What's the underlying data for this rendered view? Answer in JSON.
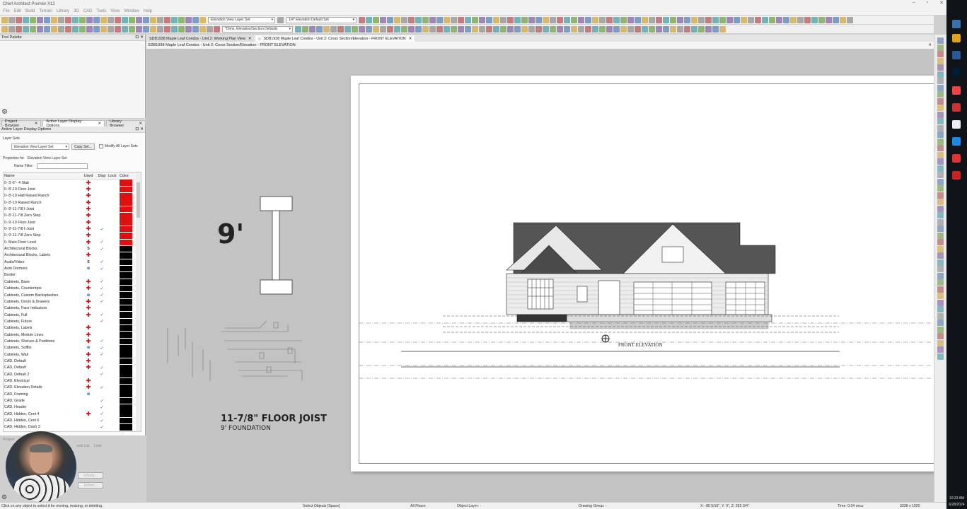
{
  "app": {
    "title": "Chief Architect Premier X12",
    "menus": [
      "File",
      "Edit",
      "Build",
      "Terrain",
      "Library",
      "3D",
      "CAD",
      "Tools",
      "View",
      "Window",
      "Help"
    ]
  },
  "toolbar": {
    "layer_set": "Elevation View Layer Set",
    "dims_default": "*Dims, Elevation/Section Defaults",
    "scale": "1/4\" Elevation Default Set"
  },
  "tool_palette": {
    "title": "Tool Palette"
  },
  "left_tabs": [
    {
      "label": "Project Browser"
    },
    {
      "label": "Active Layer Display Options"
    },
    {
      "label": "Library Browser"
    }
  ],
  "layer_panel": {
    "title": "Active Layer Display Options",
    "layer_sets_label": "Layer Sets",
    "layer_set_value": "Elevation View Layer Set",
    "copy_set": "Copy Set...",
    "modify_all": "Modify All Layer Sets",
    "properties_for": "Properties for",
    "properties_value": "Elevation View Layer Set",
    "name_filter": "Name Filter:",
    "columns": [
      "Name",
      "Used",
      "Disp",
      "Lock",
      "Color"
    ],
    "rows": [
      {
        "name": "0- 3'-6\"- 4 Slab",
        "used": "x",
        "disp": false,
        "color": "#e01010"
      },
      {
        "name": "0- 8'-10 Floor Joist",
        "used": "x",
        "disp": false,
        "color": "#e01010"
      },
      {
        "name": "0- 8'-10 Half Raised Ranch",
        "used": "x",
        "disp": false,
        "color": "#e01010"
      },
      {
        "name": "0- 8'-10 Raised Ranch",
        "used": "x",
        "disp": false,
        "color": "#e01010"
      },
      {
        "name": "0- 8'-11-7/8 I-Joist",
        "used": "x",
        "disp": false,
        "color": "#e01010"
      },
      {
        "name": "0- 8'-11-7/8 Zero Step",
        "used": "x",
        "disp": false,
        "color": "#e01010"
      },
      {
        "name": "0- 9'-10 Floor Joist",
        "used": "x",
        "disp": false,
        "color": "#e01010"
      },
      {
        "name": "0- 9'-11-7/8 I-Joist",
        "used": "x",
        "disp": true,
        "color": "#e01010"
      },
      {
        "name": "0- 9'-11-7/8 Zero Step",
        "used": "x",
        "disp": false,
        "color": "#e01010"
      },
      {
        "name": "0- Main Floor Level",
        "used": "x",
        "disp": true,
        "color": "#e01010"
      },
      {
        "name": "Architectural Blocks",
        "used": "S",
        "disp": true,
        "color": "#000000"
      },
      {
        "name": "Architectural Blocks, Labels",
        "used": "x",
        "disp": false,
        "color": "#000000"
      },
      {
        "name": "Audio/Video",
        "used": "S",
        "disp": true,
        "color": "#000000"
      },
      {
        "name": "Auto Dormers",
        "used": "lock",
        "disp": true,
        "color": "#000000"
      },
      {
        "name": "Border",
        "used": "",
        "disp": false,
        "color": "#000000"
      },
      {
        "name": "Cabinets, Base",
        "used": "x",
        "disp": true,
        "color": "#000000"
      },
      {
        "name": "Cabinets, Countertops",
        "used": "x",
        "disp": true,
        "color": "#000000"
      },
      {
        "name": "Cabinets, Custom Backsplashes",
        "used": "lock",
        "disp": true,
        "color": "#000000"
      },
      {
        "name": "Cabinets, Doors & Drawers",
        "used": "x",
        "disp": true,
        "color": "#000000"
      },
      {
        "name": "Cabinets, Face Indicators",
        "used": "x",
        "disp": false,
        "color": "#000000"
      },
      {
        "name": "Cabinets, Full",
        "used": "x",
        "disp": true,
        "color": "#000000"
      },
      {
        "name": "Cabinets, Future",
        "used": "",
        "disp": true,
        "color": "#000000"
      },
      {
        "name": "Cabinets, Labels",
        "used": "x",
        "disp": false,
        "color": "#000000"
      },
      {
        "name": "Cabinets, Module Lines",
        "used": "x",
        "disp": false,
        "color": "#000000"
      },
      {
        "name": "Cabinets, Shelves & Partitions",
        "used": "x",
        "disp": true,
        "color": "#000000"
      },
      {
        "name": "Cabinets, Soffits",
        "used": "lock",
        "disp": true,
        "color": "#000000"
      },
      {
        "name": "Cabinets, Wall",
        "used": "x",
        "disp": true,
        "color": "#000000"
      },
      {
        "name": "CAD, Default",
        "used": "x",
        "disp": false,
        "color": "#000000"
      },
      {
        "name": "CAD, Default",
        "used": "x",
        "disp": true,
        "color": "#000000"
      },
      {
        "name": "CAD, Default 2",
        "used": "",
        "disp": true,
        "color": "#000000"
      },
      {
        "name": "CAD, Electrical",
        "used": "x",
        "disp": false,
        "color": "#000000"
      },
      {
        "name": "CAD, Elevation Details",
        "used": "x",
        "disp": true,
        "color": "#000000"
      },
      {
        "name": "CAD, Framing",
        "used": "lock",
        "disp": false,
        "color": "#000000"
      },
      {
        "name": "CAD, Grade",
        "used": "",
        "disp": true,
        "color": "#000000"
      },
      {
        "name": "CAD, Header",
        "used": "",
        "disp": true,
        "color": "#000000"
      },
      {
        "name": "CAD, Hidden, Cent 4",
        "used": "x",
        "disp": true,
        "color": "#000000"
      },
      {
        "name": "CAD, Hidden, Cent 6",
        "used": "",
        "disp": true,
        "color": "#000000"
      },
      {
        "name": "CAD, Hidden, Dash 3",
        "used": "",
        "disp": true,
        "color": "#000000"
      }
    ],
    "props_label": "Propert",
    "tools_list": "ools List",
    "lock_label": "Lock",
    "library_btn": "Library...",
    "define_btn": "Define..."
  },
  "doc_tabs": [
    {
      "label": "SDB1938 Maple Leaf Condos - Unit 2:  Working Plan View"
    },
    {
      "label": "SDB1938 Maple Leaf Condos - Unit 2: Cross Section/Elevation - FRONT ELEVATION"
    }
  ],
  "doc_title": "SDB1938 Maple Leaf Condos - Unit 2: Cross Section/Elevation - FRONT ELEVATION",
  "drawing": {
    "nine_label": "9'",
    "floor_joist": "11-7/8\" FLOOR JOIST",
    "foundation": "9' FOUNDATION",
    "elevation_label": "FRONT ELEVATION"
  },
  "status": {
    "hint": "Click on any object to select it for moving, resizing, or deleting.",
    "select": "Select Objects [Space]",
    "floors": "All Floors",
    "object_layer": "Object Layer: -",
    "drawing_group": "Drawing Group: -",
    "coords": "X: -85 5/16\", Y: 0\", Z: 263 3/4\"",
    "time": "Time: 0.04 secs",
    "res": "3338 x 1920"
  },
  "clock": {
    "time": "10:23 AM",
    "date": "6/28/2024"
  }
}
